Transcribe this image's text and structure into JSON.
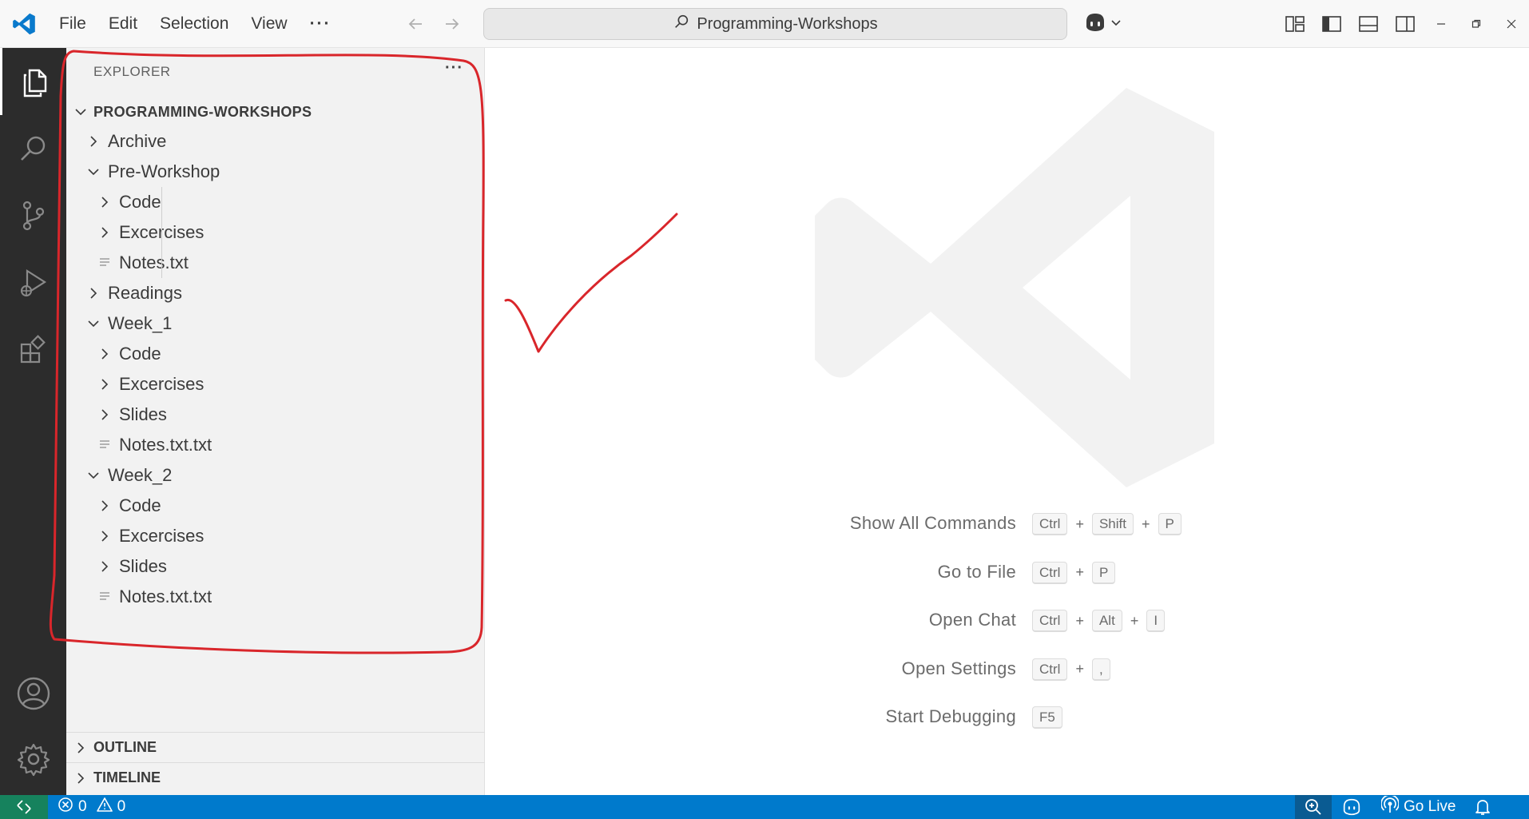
{
  "window": {
    "menu": [
      "File",
      "Edit",
      "Selection",
      "View"
    ],
    "more_menu": "···",
    "search_text": "Programming-Workshops"
  },
  "sidebar": {
    "title": "EXPLORER",
    "more": "···",
    "root": "PROGRAMMING-WORKSHOPS",
    "tree": [
      {
        "label": "Archive",
        "type": "folder",
        "expanded": false,
        "depth": 0
      },
      {
        "label": "Pre-Workshop",
        "type": "folder",
        "expanded": true,
        "depth": 0
      },
      {
        "label": "Code",
        "type": "folder",
        "expanded": false,
        "depth": 1
      },
      {
        "label": "Excercises",
        "type": "folder",
        "expanded": false,
        "depth": 1
      },
      {
        "label": "Notes.txt",
        "type": "file",
        "depth": 1
      },
      {
        "label": "Readings",
        "type": "folder",
        "expanded": false,
        "depth": 0
      },
      {
        "label": "Week_1",
        "type": "folder",
        "expanded": true,
        "depth": 0
      },
      {
        "label": "Code",
        "type": "folder",
        "expanded": false,
        "depth": 1
      },
      {
        "label": "Excercises",
        "type": "folder",
        "expanded": false,
        "depth": 1
      },
      {
        "label": "Slides",
        "type": "folder",
        "expanded": false,
        "depth": 1
      },
      {
        "label": "Notes.txt.txt",
        "type": "file",
        "depth": 1
      },
      {
        "label": "Week_2",
        "type": "folder",
        "expanded": true,
        "depth": 0
      },
      {
        "label": "Code",
        "type": "folder",
        "expanded": false,
        "depth": 1
      },
      {
        "label": "Excercises",
        "type": "folder",
        "expanded": false,
        "depth": 1
      },
      {
        "label": "Slides",
        "type": "folder",
        "expanded": false,
        "depth": 1
      },
      {
        "label": "Notes.txt.txt",
        "type": "file",
        "depth": 1
      }
    ],
    "outline": "OUTLINE",
    "timeline": "TIMELINE"
  },
  "shortcuts": [
    {
      "label": "Show All Commands",
      "keys": [
        "Ctrl",
        "Shift",
        "P"
      ]
    },
    {
      "label": "Go to File",
      "keys": [
        "Ctrl",
        "P"
      ]
    },
    {
      "label": "Open Chat",
      "keys": [
        "Ctrl",
        "Alt",
        "I"
      ]
    },
    {
      "label": "Open Settings",
      "keys": [
        "Ctrl",
        ","
      ]
    },
    {
      "label": "Start Debugging",
      "keys": [
        "F5"
      ]
    }
  ],
  "statusbar": {
    "errors": "0",
    "warnings": "0",
    "go_live": "Go Live"
  },
  "colors": {
    "accent": "#007acc",
    "remote": "#16825d",
    "annotation": "#d9262b",
    "activity_bar": "#2c2c2c"
  }
}
